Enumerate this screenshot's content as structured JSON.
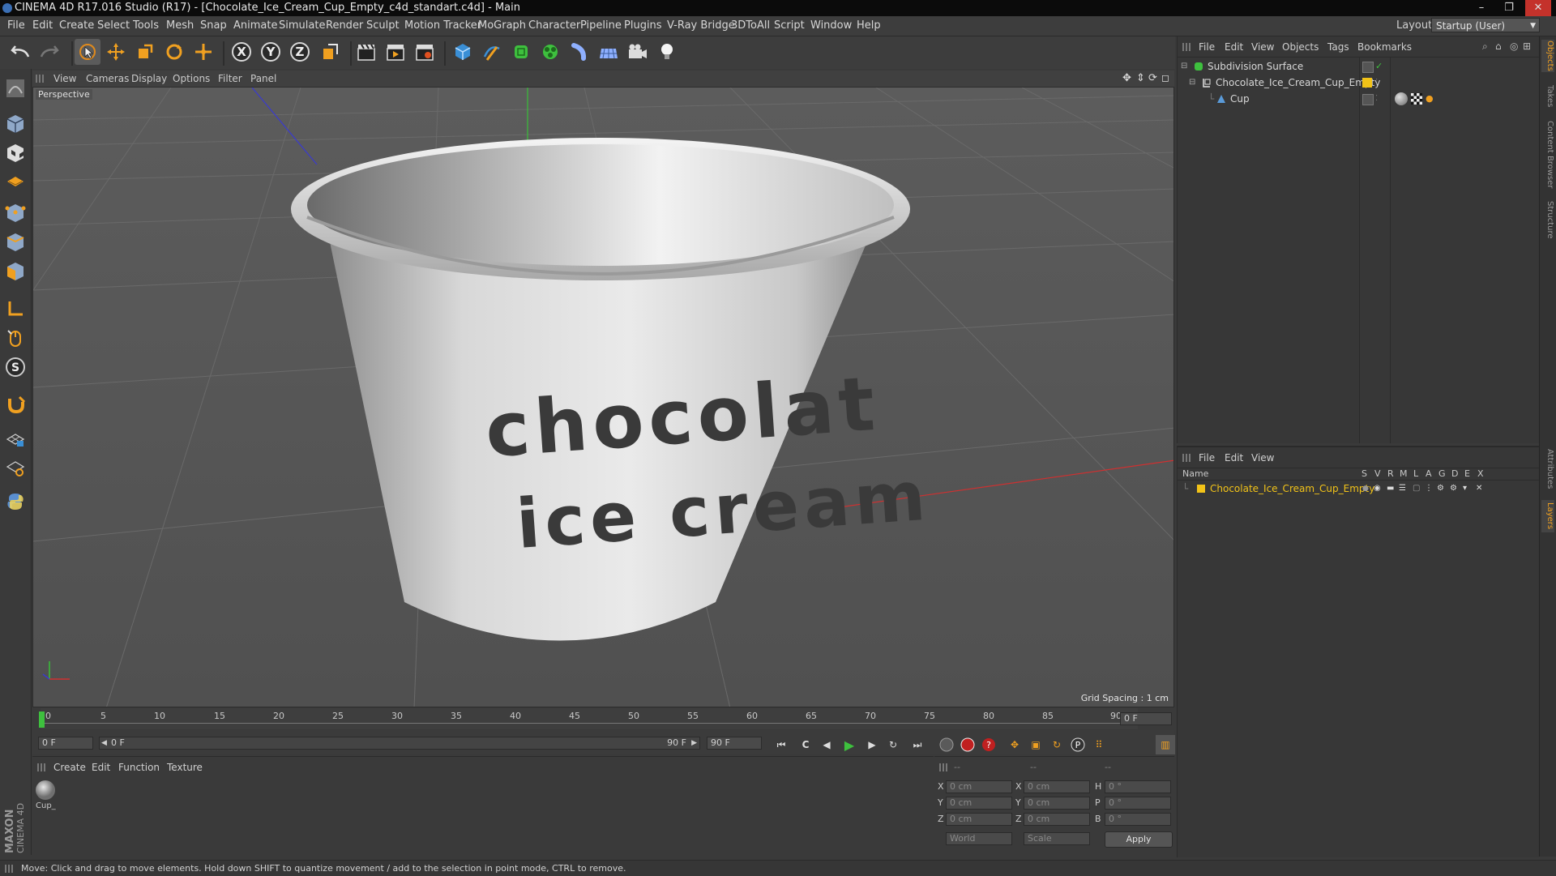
{
  "window": {
    "title": "CINEMA 4D R17.016 Studio (R17) - [Chocolate_Ice_Cream_Cup_Empty_c4d_standart.c4d] - Main",
    "controls": [
      "–",
      "❐",
      "✕"
    ]
  },
  "menubar": {
    "items": [
      "File",
      "Edit",
      "Create",
      "Select",
      "Tools",
      "Mesh",
      "Snap",
      "Animate",
      "Simulate",
      "Render",
      "Sculpt",
      "Motion Tracker",
      "MoGraph",
      "Character",
      "Pipeline",
      "Plugins",
      "V-Ray Bridge",
      "3DToAll",
      "Script",
      "Window",
      "Help"
    ],
    "layout_label": "Layout:",
    "layout_value": "Startup (User)"
  },
  "toolbar": {
    "axis_x": "X",
    "axis_y": "Y",
    "axis_z": "Z"
  },
  "viewport": {
    "menus": [
      "View",
      "Cameras",
      "Display",
      "Options",
      "Filter",
      "Panel"
    ],
    "label": "Perspective",
    "grid_spacing": "Grid Spacing : 1 cm",
    "cup_text_line1": "chocolat",
    "cup_text_line2": "ice cream"
  },
  "timeline": {
    "ticks": [
      "0",
      "5",
      "10",
      "15",
      "20",
      "25",
      "30",
      "35",
      "40",
      "45",
      "50",
      "55",
      "60",
      "65",
      "70",
      "75",
      "80",
      "85",
      "90"
    ],
    "current_frame": "0 F"
  },
  "framebar": {
    "start_field": "0 F",
    "range_start": "0 F",
    "range_end": "90 F",
    "end_field": "90 F"
  },
  "material_manager": {
    "menus": [
      "Create",
      "Edit",
      "Function",
      "Texture"
    ],
    "material_label": "Cup_"
  },
  "coordinates": {
    "headers": [
      "--",
      "--",
      "--"
    ],
    "rows": [
      {
        "a": "X",
        "a_val": "0 cm",
        "b": "X",
        "b_val": "0 cm",
        "c": "H",
        "c_val": "0 °"
      },
      {
        "a": "Y",
        "a_val": "0 cm",
        "b": "Y",
        "b_val": "0 cm",
        "c": "P",
        "c_val": "0 °"
      },
      {
        "a": "Z",
        "a_val": "0 cm",
        "b": "Z",
        "b_val": "0 cm",
        "c": "B",
        "c_val": "0 °"
      }
    ],
    "mode_world": "World",
    "mode_scale": "Scale",
    "apply": "Apply"
  },
  "object_manager": {
    "menus": [
      "File",
      "Edit",
      "View",
      "Objects",
      "Tags",
      "Bookmarks"
    ],
    "objects": [
      "Subdivision Surface",
      "Chocolate_Ice_Cream_Cup_Empty",
      "Cup"
    ]
  },
  "layer_manager": {
    "menus": [
      "File",
      "Edit",
      "View"
    ],
    "name_header": "Name",
    "col_headers": [
      "S",
      "V",
      "R",
      "M",
      "L",
      "A",
      "G",
      "D",
      "E",
      "X"
    ],
    "layer_name": "Chocolate_Ice_Cream_Cup_Empty"
  },
  "right_tabs": [
    "Objects",
    "Takes",
    "Content Browser",
    "Structure",
    "Attributes",
    "Layers"
  ],
  "brand": {
    "maxon": "MAXON",
    "cinema": "CINEMA 4D"
  },
  "statusbar": {
    "text": "Move: Click and drag to move elements. Hold down SHIFT to quantize movement / add to the selection in point mode, CTRL to remove."
  },
  "colors": {
    "layer_yellow": "#f2c318",
    "selection_green": "#3ec03e",
    "accent_orange": "#f0a020"
  }
}
